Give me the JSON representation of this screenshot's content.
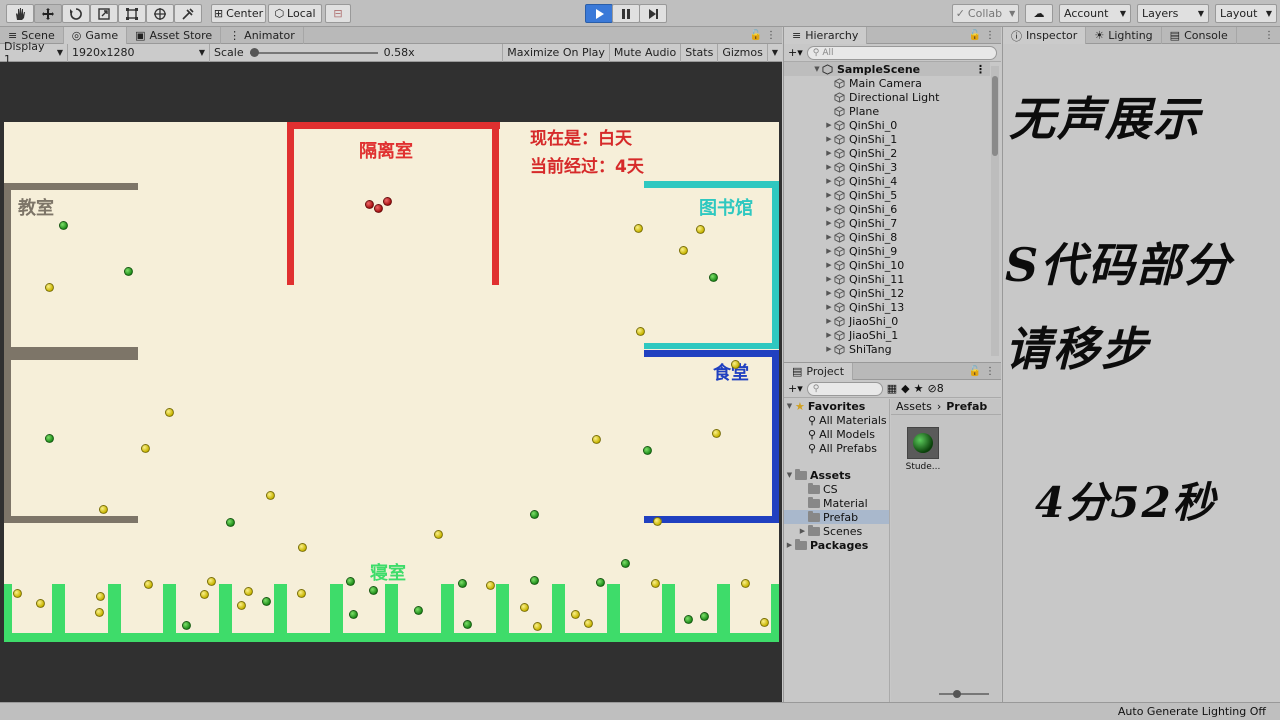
{
  "toolbar": {
    "pivot_label": "Center",
    "space_label": "Local",
    "collab_label": "Collab",
    "account_label": "Account",
    "layers_label": "Layers",
    "layout_label": "Layout"
  },
  "game_panel": {
    "tabs": [
      "Scene",
      "Game",
      "Asset Store",
      "Animator"
    ],
    "display": "Display 1",
    "resolution": "1920x1280",
    "scale_label": "Scale",
    "scale_value": "0.58x",
    "scale_fraction": 0.02,
    "maximize_label": "Maximize On Play",
    "mute_label": "Mute Audio",
    "stats_label": "Stats",
    "gizmos_label": "Gizmos"
  },
  "game_view": {
    "info_line1": "现在是：白天",
    "info_line2": "当前经过：4天",
    "rooms": {
      "isolation": "隔离室",
      "classroom": "教室",
      "library": "图书馆",
      "canteen": "食堂",
      "dormitory": "寝室"
    },
    "colors": {
      "isolation_wall": "#e03030",
      "classroom_wall": "#7d7568",
      "library_wall": "#2ec8c0",
      "canteen_wall": "#2040c0",
      "dormitory_wall": "#3edc6a",
      "background": "#f6efd9"
    }
  },
  "hierarchy": {
    "title": "Hierarchy",
    "search_placeholder": "All",
    "scene_name": "SampleScene",
    "items": [
      "Main Camera",
      "Directional Light",
      "Plane",
      "QinShi_0",
      "QinShi_1",
      "QinShi_2",
      "QinShi_3",
      "QinShi_4",
      "QinShi_5",
      "QinShi_6",
      "QinShi_7",
      "QinShi_8",
      "QinShi_9",
      "QinShi_10",
      "QinShi_11",
      "QinShi_12",
      "QinShi_13",
      "JiaoShi_0",
      "JiaoShi_1",
      "ShiTang"
    ]
  },
  "project": {
    "title": "Project",
    "hidden_count": "8",
    "favorites_label": "Favorites",
    "favorites": [
      "All Materials",
      "All Models",
      "All Prefabs"
    ],
    "assets_label": "Assets",
    "asset_folders": [
      "CS",
      "Material",
      "Prefab",
      "Scenes"
    ],
    "packages_label": "Packages",
    "breadcrumb_root": "Assets",
    "breadcrumb_current": "Prefab",
    "asset_item": "Stude..."
  },
  "inspector": {
    "tabs": [
      "Inspector",
      "Lighting",
      "Console"
    ],
    "overlay_line1": "无声展示",
    "overlay_line2": "S代码部分",
    "overlay_line3": "请移步",
    "overlay_line4": "4分52秒"
  },
  "status": {
    "text": "Auto Generate Lighting Off"
  }
}
